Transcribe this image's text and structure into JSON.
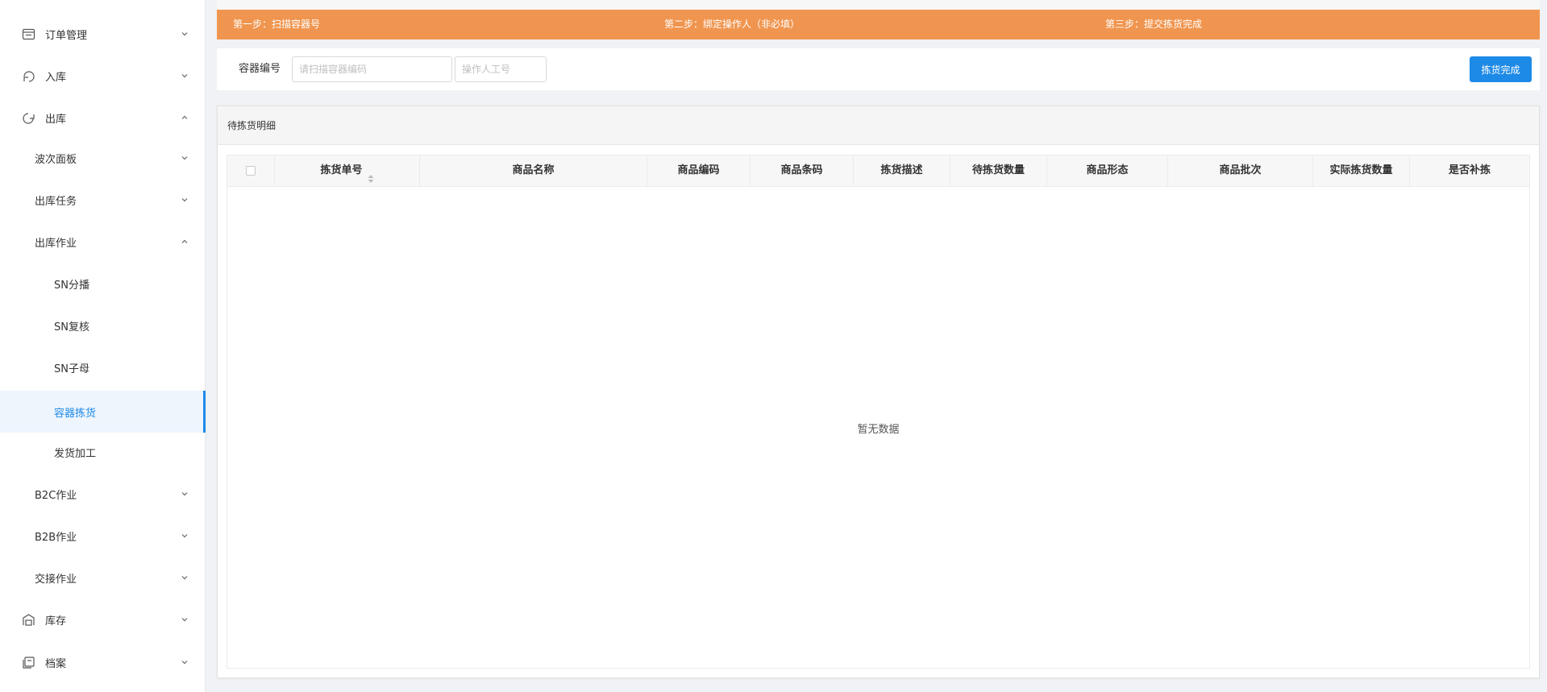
{
  "sidebar": {
    "items": [
      {
        "label": "订单管理",
        "icon": "order-icon",
        "expanded": false
      },
      {
        "label": "入库",
        "icon": "inbound-icon",
        "expanded": false
      },
      {
        "label": "出库",
        "icon": "outbound-icon",
        "expanded": true
      },
      {
        "label": "波次面板",
        "expanded": false
      },
      {
        "label": "出库任务",
        "expanded": false
      },
      {
        "label": "出库作业",
        "expanded": true
      },
      {
        "label": "SN分播"
      },
      {
        "label": "SN复核"
      },
      {
        "label": "SN子母"
      },
      {
        "label": "容器拣货",
        "active": true
      },
      {
        "label": "发货加工"
      },
      {
        "label": "B2C作业",
        "expanded": false
      },
      {
        "label": "B2B作业",
        "expanded": false
      },
      {
        "label": "交接作业",
        "expanded": false
      },
      {
        "label": "库存",
        "icon": "inventory-icon",
        "expanded": false
      },
      {
        "label": "档案",
        "icon": "archive-icon",
        "expanded": false
      }
    ]
  },
  "steps": {
    "step1": "第一步：扫描容器号",
    "step2": "第二步：绑定操作人（非必填）",
    "step3": "第三步：提交拣货完成"
  },
  "search": {
    "container_label": "容器编号",
    "container_placeholder": "请扫描容器编码",
    "operator_placeholder": "操作人工号",
    "submit_label": "拣货完成"
  },
  "card": {
    "title": "待拣货明细"
  },
  "table": {
    "columns": [
      "拣货单号",
      "商品名称",
      "商品编码",
      "商品条码",
      "拣货描述",
      "待拣货数量",
      "商品形态",
      "商品批次",
      "实际拣货数量",
      "是否补拣"
    ],
    "empty_text": "暂无数据"
  },
  "colors": {
    "accent": "#1e8ae7",
    "steps_bar": "#f0954f"
  }
}
